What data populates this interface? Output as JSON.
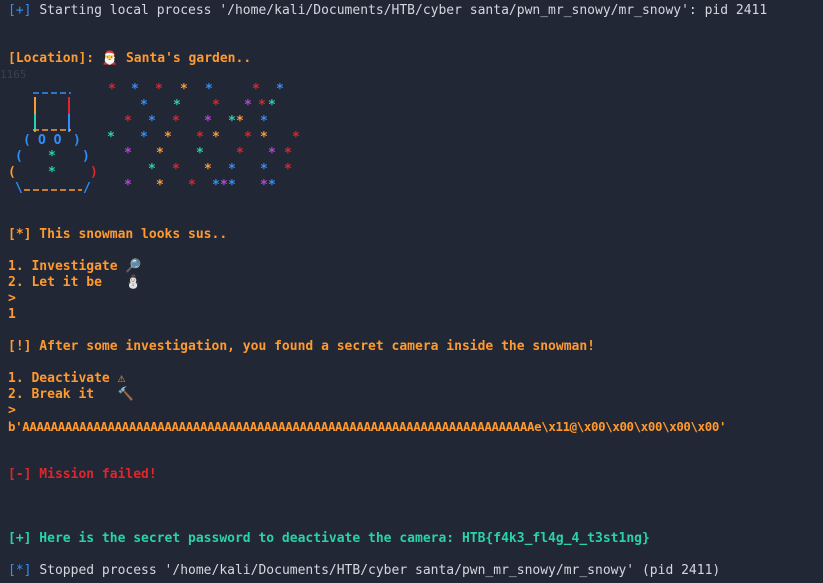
{
  "terminal": {
    "start_line": {
      "marker": "[+]",
      "text": "Starting local process '/home/kali/Documents/HTB/cyber santa/pwn_mr_snowy/mr_snowy': pid 2411"
    },
    "location": {
      "label": "[Location]:",
      "icon": "santa-emoji",
      "icon_char": "🎅",
      "text": "Santa's garden.."
    },
    "faint_number": "1165",
    "sus_line": "[*] This snowman looks sus..",
    "menu1": {
      "item1": "1. Investigate",
      "item1_icon": "🔎",
      "item2": "2. Let it be",
      "item2_icon": "⛄"
    },
    "prompt1": ">",
    "input1": "1",
    "found_line": "[!] After some investigation, you found a secret camera inside the snowman!",
    "menu2": {
      "item1": "1. Deactivate",
      "item1_icon": "⚠",
      "item2": "2. Break it",
      "item2_icon": "🔨"
    },
    "prompt2": ">",
    "payload": "b'AAAAAAAAAAAAAAAAAAAAAAAAAAAAAAAAAAAAAAAAAAAAAAAAAAAAAAAAAAAAAAAAAAAAAAAAe\\x11@\\x00\\x00\\x00\\x00\\x00'",
    "failed_line": "[-] Mission failed!",
    "password_line": {
      "text": "[+] Here is the secret password to deactivate the camera:",
      "flag": "HTB{f4k3_fl4g_4_t3st1ng}"
    },
    "stop_line": {
      "marker": "[*]",
      "text": "Stopped process '/home/kali/Documents/HTB/cyber santa/pwn_mr_snowy/mr_snowy' (pid 2411)"
    }
  },
  "art": {
    "snowman_lines": [
      "  ____",
      " |    |",
      " |____|",
      " ( O O )",
      "(   *   )",
      "(    *    )",
      " \\_____/"
    ],
    "star_char": "*"
  },
  "colors": {
    "background": "#222735",
    "text": "#d3d7df",
    "blue": "#2f8fff",
    "orange": "#ff9a2e",
    "red": "#e0262c",
    "green": "#29d3a9",
    "purple": "#b845d8"
  }
}
